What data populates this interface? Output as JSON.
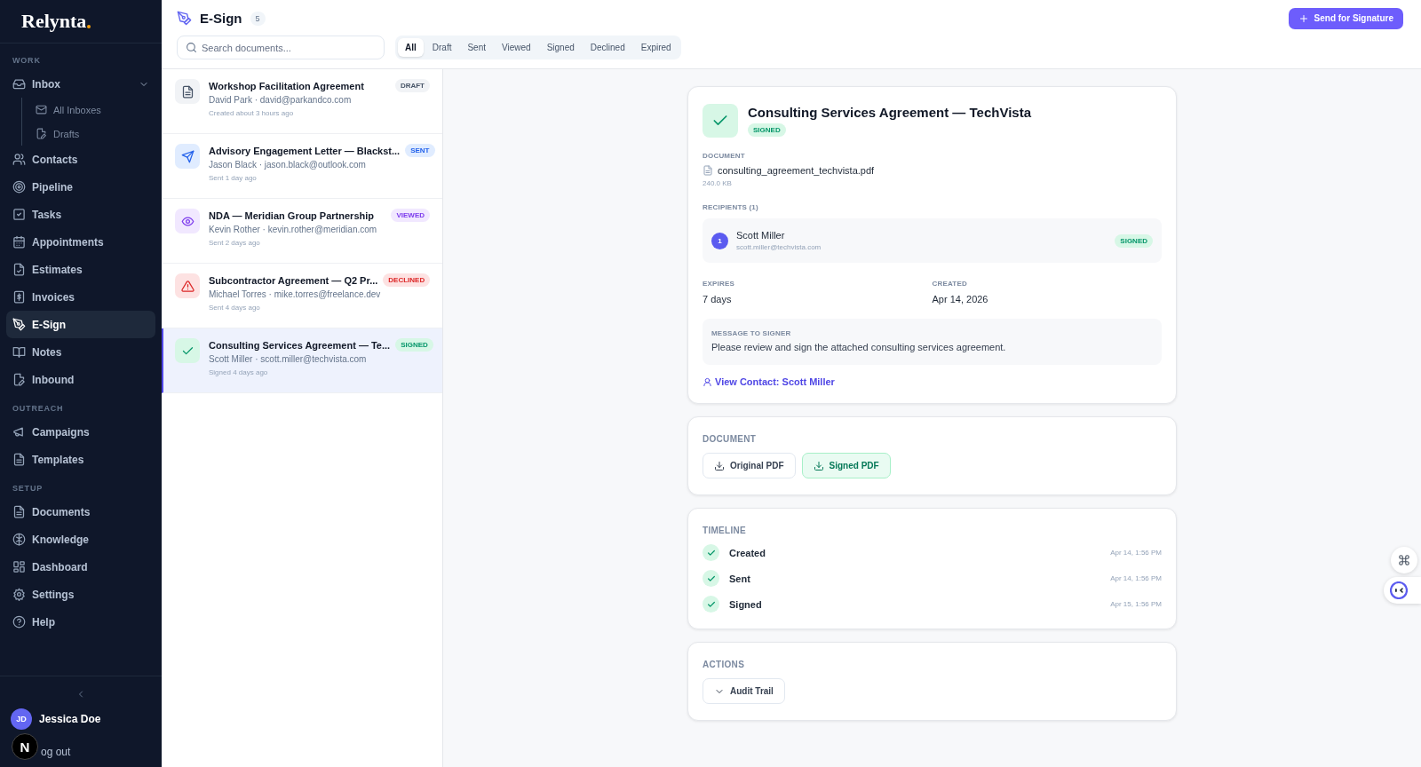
{
  "sidebar": {
    "logo": "Relynta",
    "sections": [
      {
        "heading": "WORK",
        "items": [
          {
            "label": "Inbox",
            "selected": false,
            "expanded": true,
            "children": [
              {
                "label": "All Inboxes",
                "selected": false
              },
              {
                "label": "Drafts",
                "selected": false
              }
            ]
          },
          {
            "label": "Contacts",
            "selected": false
          },
          {
            "label": "Pipeline",
            "selected": false
          },
          {
            "label": "Tasks",
            "selected": false
          },
          {
            "label": "Appointments",
            "selected": false
          },
          {
            "label": "Estimates",
            "selected": false
          },
          {
            "label": "Invoices",
            "selected": false
          },
          {
            "label": "E-Sign",
            "selected": true
          },
          {
            "label": "Notes",
            "selected": false
          },
          {
            "label": "Inbound",
            "selected": false
          }
        ]
      },
      {
        "heading": "OUTREACH",
        "items": [
          {
            "label": "Campaigns",
            "selected": false
          },
          {
            "label": "Templates",
            "selected": false
          }
        ]
      },
      {
        "heading": "SETUP",
        "items": [
          {
            "label": "Documents",
            "selected": false
          },
          {
            "label": "Knowledge",
            "selected": false
          },
          {
            "label": "Dashboard",
            "selected": false
          },
          {
            "label": "Settings",
            "selected": false
          },
          {
            "label": "Help",
            "selected": false
          }
        ]
      }
    ],
    "user": {
      "initials": "JD",
      "name": "Jessica Doe"
    },
    "logout": "og out",
    "dev_badge": "N"
  },
  "header": {
    "title": "E-Sign",
    "count": "5",
    "search": {
      "placeholder": "Search documents..."
    },
    "filters": [
      {
        "label": "All",
        "selected": true
      },
      {
        "label": "Draft",
        "selected": false
      },
      {
        "label": "Sent",
        "selected": false
      },
      {
        "label": "Viewed",
        "selected": false
      },
      {
        "label": "Signed",
        "selected": false
      },
      {
        "label": "Declined",
        "selected": false
      },
      {
        "label": "Expired",
        "selected": false
      }
    ],
    "primary_button": "Send for Signature"
  },
  "documents": [
    {
      "title": "Workshop Facilitation Agreement",
      "subtitle": "David Park · david@parkandco.com",
      "time": "Created about 3 hours ago",
      "status": {
        "label": "DRAFT",
        "kind": "draft"
      },
      "selected": false
    },
    {
      "title": "Advisory Engagement Letter — Blackst...",
      "subtitle": "Jason Black · jason.black@outlook.com",
      "time": "Sent 1 day ago",
      "status": {
        "label": "SENT",
        "kind": "sent"
      },
      "selected": false
    },
    {
      "title": "NDA — Meridian Group Partnership",
      "subtitle": "Kevin Rother · kevin.rother@meridian.com",
      "time": "Sent 2 days ago",
      "status": {
        "label": "VIEWED",
        "kind": "viewed"
      },
      "selected": false
    },
    {
      "title": "Subcontractor Agreement — Q2 Pr...",
      "subtitle": "Michael Torres · mike.torres@freelance.dev",
      "time": "Sent 4 days ago",
      "status": {
        "label": "DECLINED",
        "kind": "declined"
      },
      "selected": false
    },
    {
      "title": "Consulting Services Agreement — Te...",
      "subtitle": "Scott Miller · scott.miller@techvista.com",
      "time": "Signed 4 days ago",
      "status": {
        "label": "SIGNED",
        "kind": "signed"
      },
      "selected": true
    }
  ],
  "detail": {
    "title": "Consulting Services Agreement — TechVista",
    "status": {
      "label": "SIGNED",
      "kind": "signed"
    },
    "document": {
      "label": "DOCUMENT",
      "filename": "consulting_agreement_techvista.pdf",
      "size": "240.0 KB"
    },
    "recipients": {
      "label": "RECIPIENTS (1)",
      "items": [
        {
          "number": "1",
          "name": "Scott Miller",
          "email": "scott.miller@techvista.com",
          "status": {
            "label": "SIGNED",
            "kind": "signed"
          }
        }
      ]
    },
    "fields": [
      {
        "label": "EXPIRES",
        "value": "7 days"
      },
      {
        "label": "CREATED",
        "value": "Apr 14, 2026"
      }
    ],
    "message": {
      "label": "MESSAGE TO SIGNER",
      "text": "Please review and sign the attached consulting services agreement."
    },
    "contact_link": "View Contact: Scott Miller"
  },
  "downloads": {
    "heading": "DOCUMENT",
    "buttons": [
      {
        "label": "Original PDF",
        "kind": "plain"
      },
      {
        "label": "Signed PDF",
        "kind": "signed"
      }
    ]
  },
  "timeline": {
    "heading": "TIMELINE",
    "events": [
      {
        "label": "Created",
        "time": "Apr 14, 1:56 PM",
        "done": true
      },
      {
        "label": "Sent",
        "time": "Apr 14, 1:56 PM",
        "done": true
      },
      {
        "label": "Signed",
        "time": "Apr 15, 1:56 PM",
        "done": true
      }
    ]
  },
  "actions": {
    "heading": "ACTIONS",
    "buttons": [
      {
        "label": "Audit Trail"
      }
    ]
  }
}
